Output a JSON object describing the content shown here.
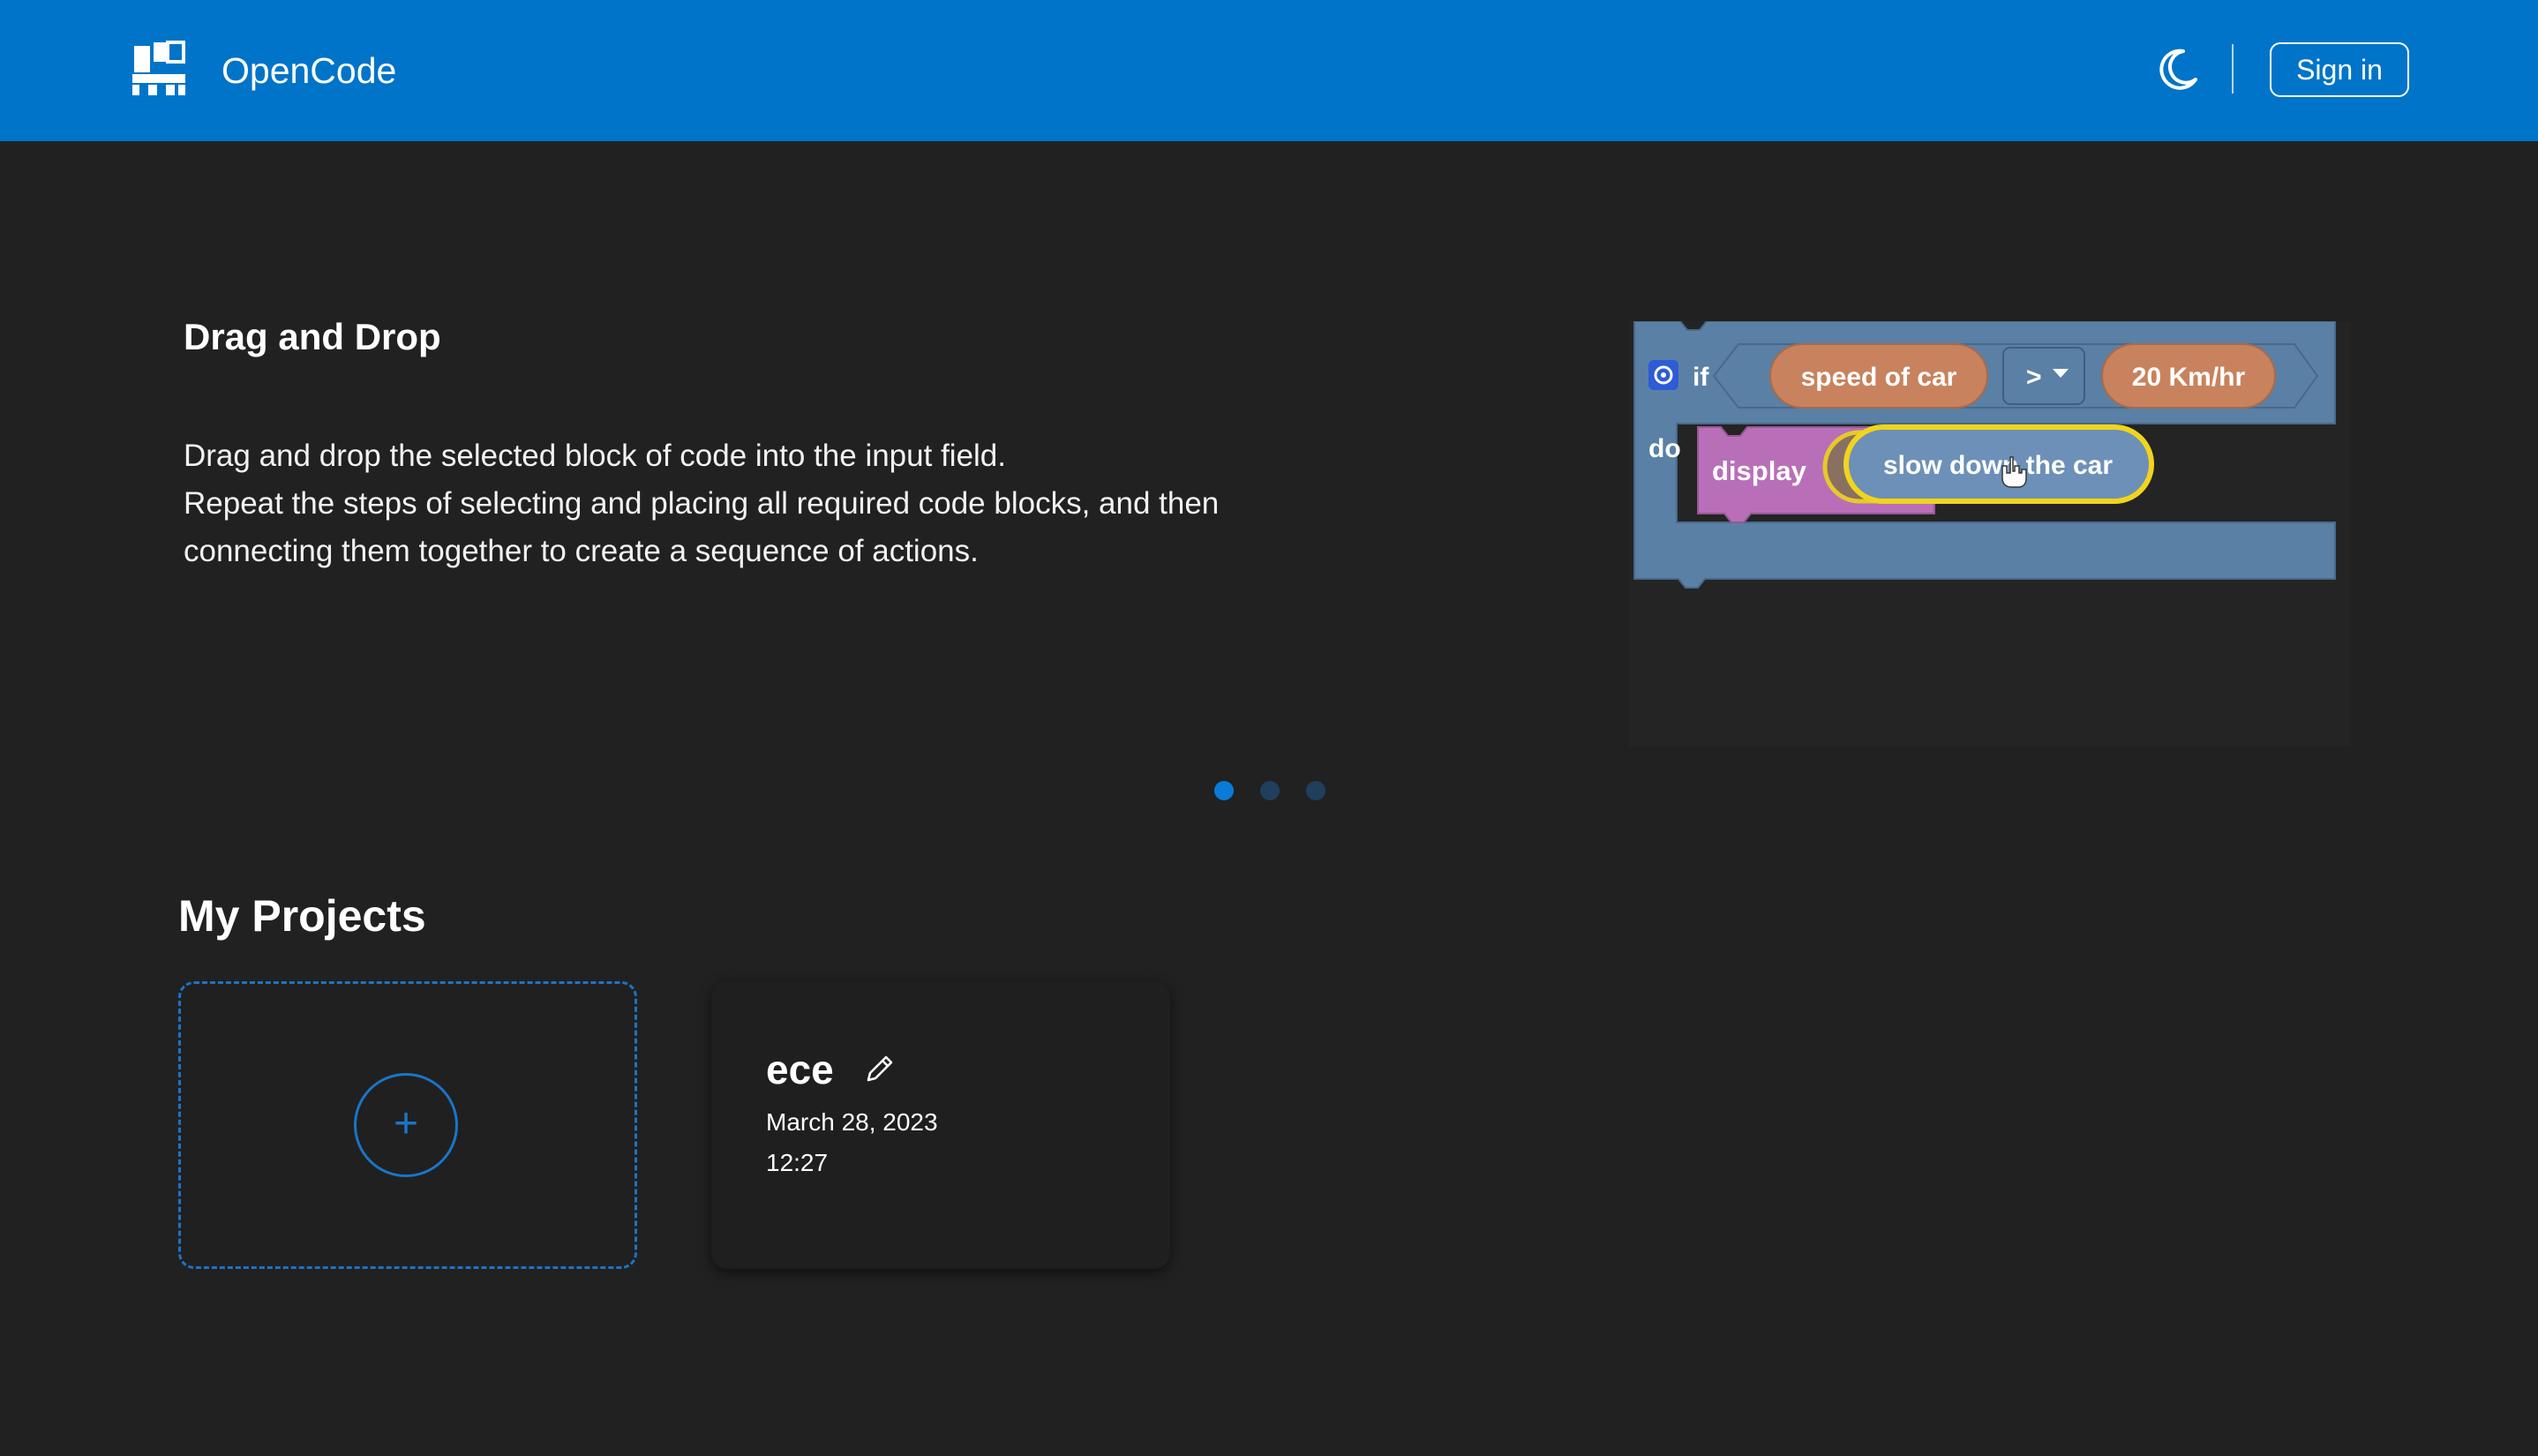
{
  "header": {
    "logo_icon": "opencode-logo-icon",
    "app_title": "OpenCode",
    "theme_toggle_icon": "moon-icon",
    "signin_label": "Sign in",
    "bg_color": "#0074c8"
  },
  "carousel": {
    "slide_title": "Drag and Drop",
    "slide_description_lines": [
      "Drag and drop the selected block of code into the input field.",
      "Repeat the steps of selecting and placing all required code blocks, and then",
      "connecting them together to create a sequence of actions."
    ],
    "demo_blocks": {
      "if_label": "if",
      "do_label": "do",
      "condition_left": "speed of car",
      "operator": ">",
      "condition_right": "20 Km/hr",
      "action_label": "display",
      "action_value": "slow down the car"
    },
    "dots": [
      {
        "state": "active",
        "color": "#0a7bd6"
      },
      {
        "state": "inactive",
        "color": "#1f3f5c"
      },
      {
        "state": "inactive",
        "color": "#1f3f5c"
      }
    ]
  },
  "projects": {
    "section_title": "My Projects",
    "new_project_icon": "plus-icon",
    "new_project_symbol": "+",
    "items": [
      {
        "name": "ece",
        "date": "March 28, 2023",
        "time": "12:27",
        "edit_icon": "pencil-icon"
      }
    ]
  },
  "colors": {
    "background": "#212121",
    "accent": "#1a75c6"
  }
}
